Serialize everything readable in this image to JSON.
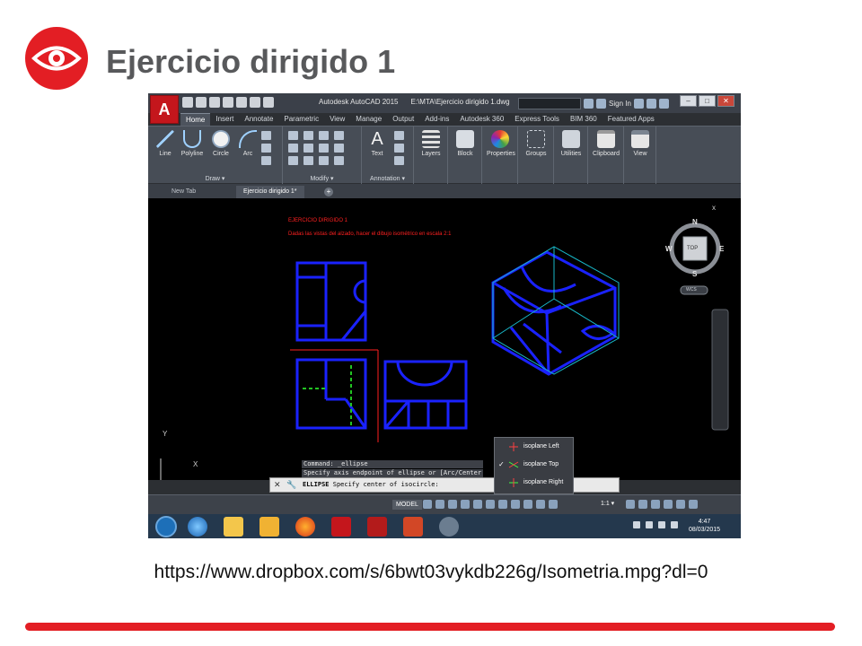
{
  "slide": {
    "title": "Ejercicio dirigido 1",
    "url": "https://www.dropbox.com/s/6bwt03vykdb226g/Isometria.mpg?dl=0",
    "accent_color": "#e31e24",
    "logo_icon": "eye-icon"
  },
  "app": {
    "name": "Autodesk AutoCAD 2015",
    "file_path": "E:\\MTA\\Ejercicio dirigido 1.dwg",
    "signin": "Sign In",
    "app_button": "A"
  },
  "ribbon": {
    "tabs": [
      "Home",
      "Insert",
      "Annotate",
      "Parametric",
      "View",
      "Manage",
      "Output",
      "Add-ins",
      "Autodesk 360",
      "Express Tools",
      "BIM 360",
      "Featured Apps"
    ],
    "active_tab": "Home",
    "draw": {
      "label": "Draw ▾",
      "tools": [
        "Line",
        "Polyline",
        "Circle",
        "Arc"
      ]
    },
    "modify": {
      "label": "Modify ▾"
    },
    "annotation": {
      "label": "Annotation ▾",
      "text_tool": "Text"
    },
    "big_tools": [
      "Layers",
      "Block",
      "Properties",
      "Groups",
      "Utilities",
      "Clipboard",
      "View"
    ]
  },
  "file_tabs": {
    "new_tab": "New Tab",
    "active": "Ejercicio dirigido 1*",
    "add": "+"
  },
  "drawing": {
    "heading": "EJERCICIO DIRIGIDO 1",
    "description": "Dadas las vistas del alzado, hacer el dibujo isométrico en escala 2:1",
    "viewcube": {
      "north": "N",
      "south": "S",
      "east": "E",
      "west": "W",
      "top": "TOP",
      "wcs": "WCS"
    },
    "ucs": {
      "x": "X",
      "y": "Y"
    },
    "close_label": "x"
  },
  "command": {
    "history": [
      "Command: _ellipse",
      "Specify axis endpoint of ellipse or [Arc/Center"
    ],
    "prompt_cmd": "ELLIPSE",
    "prompt_text": "Specify center of isocircle:",
    "close": "✕",
    "wrench": "🔧"
  },
  "iso_menu": {
    "items": [
      {
        "label": "isoplane Left",
        "checked": false
      },
      {
        "label": "isoplane Top",
        "checked": true
      },
      {
        "label": "isoplane Right",
        "checked": false
      }
    ],
    "check_glyph": "✓"
  },
  "statusbar": {
    "model": "MODEL",
    "scale": "1:1 ▾"
  },
  "taskbar": {
    "time": "4:47",
    "date": "08/03/2015"
  }
}
